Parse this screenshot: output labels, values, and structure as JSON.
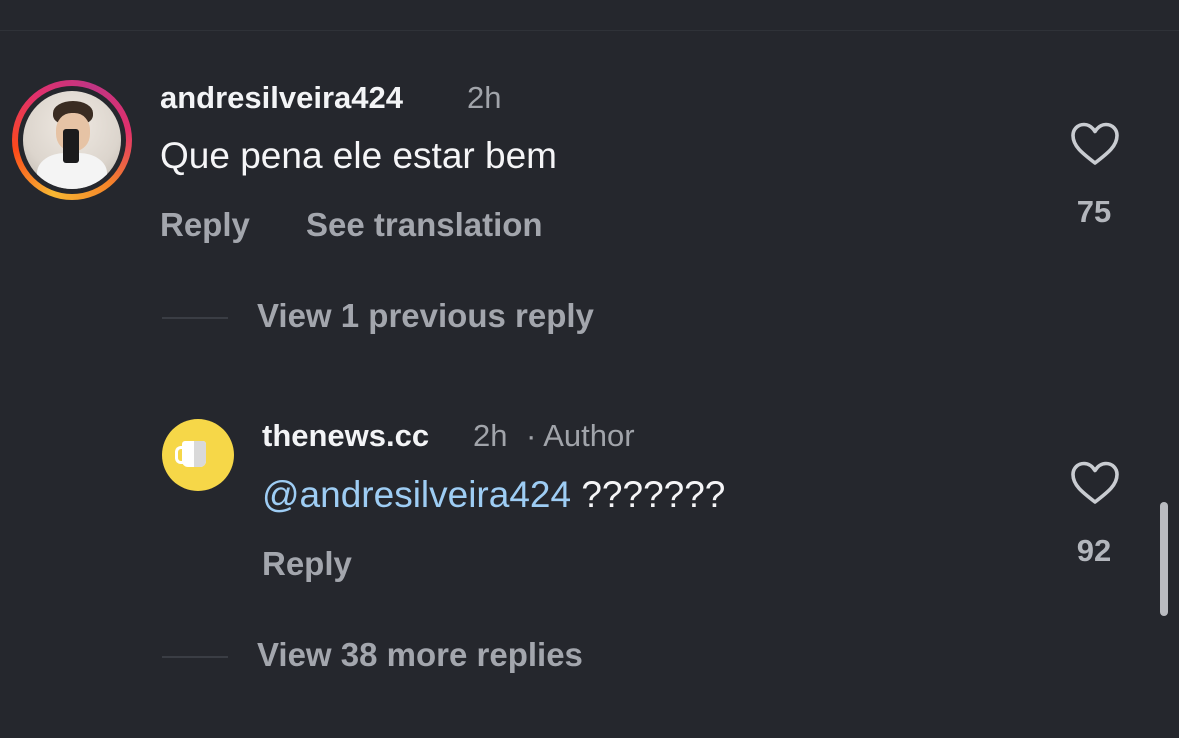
{
  "comments": [
    {
      "username": "andresilveira424",
      "time": "2h",
      "text": "Que pena ele estar bem",
      "reply_label": "Reply",
      "translate_label": "See translation",
      "likes": "75",
      "view_replies": "View 1 previous reply"
    },
    {
      "username": "thenews.cc",
      "time": "2h",
      "author_tag": "· Author",
      "mention": "@andresilveira424",
      "text": " ???????",
      "reply_label": "Reply",
      "likes": "92",
      "view_replies": "View 38 more replies"
    }
  ],
  "icons": {
    "like": "heart-outline-icon",
    "avatar2_emoji": "coffee-mug-icon"
  },
  "colors": {
    "background": "#25272d",
    "mention": "#9ecdf4",
    "avatar2_bg": "#f6d748"
  }
}
